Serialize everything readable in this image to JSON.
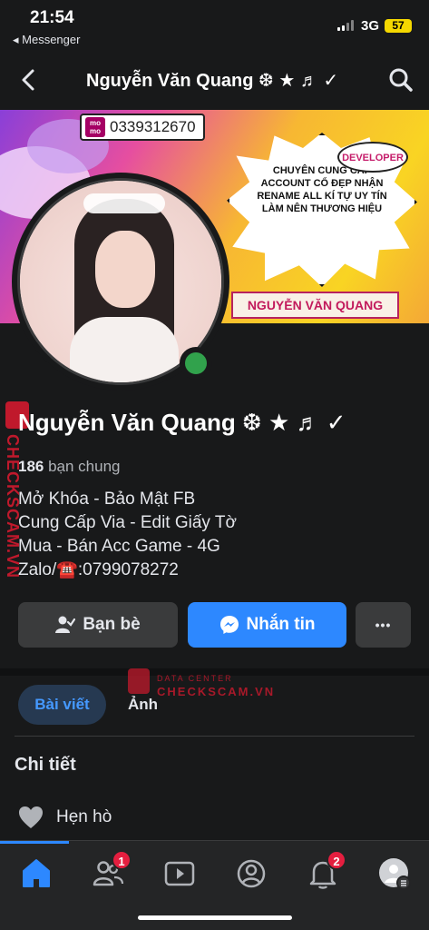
{
  "status_bar": {
    "time": "21:54",
    "back_app": "◂ Messenger",
    "network": "3G",
    "battery": "57"
  },
  "nav": {
    "title": "Nguyễn Văn Quang ❆ ★ ♬ ✓",
    "icons": [
      "back-chevron-icon",
      "search-icon"
    ]
  },
  "cover": {
    "phone": "0339312670",
    "momo_label": "mo mo",
    "badge": "DEVELOPER",
    "slogan": "Chuyên cung cấp account cổ đẹp nhận rename all kí tự uy tín làm nên thương hiệu",
    "banner_name": "NGUYỄN VĂN QUANG"
  },
  "profile": {
    "name": "Nguyễn Văn Quang ❆ ★ ♬ ✓",
    "mutual_count": "186",
    "mutual_label": " bạn chung",
    "bio": [
      "Mở Khóa - Bảo Mật FB",
      "Cung Cấp Via - Edit Giấy Tờ",
      "Mua - Bán Acc Game - 4G",
      "Zalo/☎️:0799078272"
    ]
  },
  "watermark": {
    "vertical": "CHECKSCAM.VN",
    "sub": "DATA CENTER",
    "main": "CHECKSCAM.VN"
  },
  "actions": {
    "friends": "Bạn bè",
    "message": "Nhắn tin",
    "more": "•••"
  },
  "tabs": {
    "posts": "Bài viết",
    "photos": "Ảnh"
  },
  "details": {
    "title": "Chi tiết",
    "dating": "Hẹn hò"
  },
  "tabbar": {
    "items": [
      "home-icon",
      "friends-icon",
      "watch-icon",
      "profile-icon",
      "notifications-icon",
      "menu-avatar-icon"
    ],
    "friends_badge": "1",
    "notif_badge": "2"
  },
  "colors": {
    "accent": "#2d88ff",
    "background": "#18191a",
    "surface": "#3a3b3c",
    "badge": "#e41e3f",
    "online": "#31a24c"
  }
}
